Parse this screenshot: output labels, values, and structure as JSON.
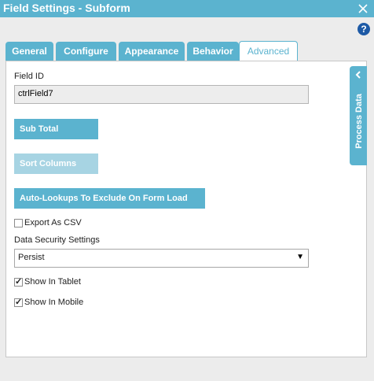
{
  "window": {
    "title": "Field Settings - Subform",
    "close_icon": "close-icon",
    "help_icon": "help-icon",
    "help_glyph": "?"
  },
  "tabs": [
    {
      "label": "General",
      "active": false
    },
    {
      "label": "Configure",
      "active": false
    },
    {
      "label": "Appearance",
      "active": false
    },
    {
      "label": "Behavior",
      "active": false
    },
    {
      "label": "Advanced",
      "active": true
    }
  ],
  "side_panel": {
    "label": "Process Data",
    "icon": "chevron-left-icon"
  },
  "form": {
    "field_id_label": "Field ID",
    "field_id_value": "ctrlField7",
    "sub_total_button": "Sub Total",
    "sort_columns_button": "Sort Columns",
    "auto_lookups_button": "Auto-Lookups To Exclude On Form Load Or Edit",
    "export_csv_label": "Export As CSV",
    "export_csv_checked": false,
    "data_security_label": "Data Security Settings",
    "data_security_value": "Persist",
    "show_tablet_label": "Show In Tablet",
    "show_tablet_checked": true,
    "show_mobile_label": "Show In Mobile",
    "show_mobile_checked": true
  },
  "colors": {
    "accent": "#5bb3cf",
    "accent_disabled": "#a7d4e3",
    "help": "#1d5aa6"
  }
}
